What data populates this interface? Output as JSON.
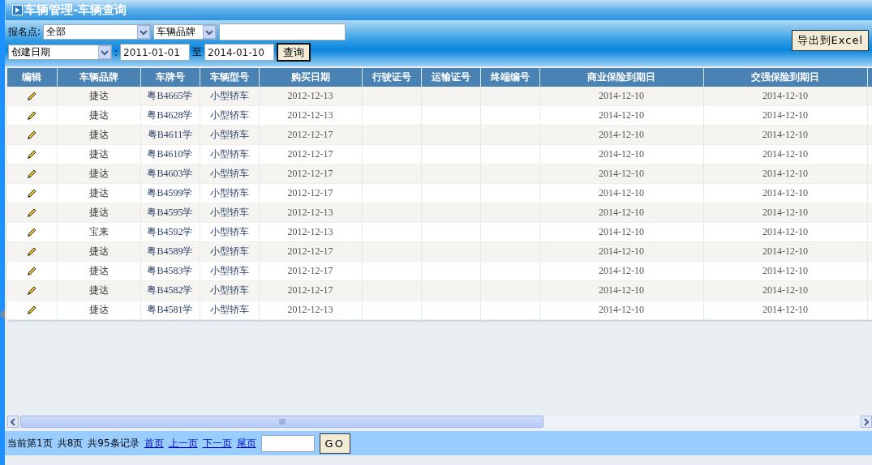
{
  "window": {
    "title": "车辆管理-车辆查询"
  },
  "filters": {
    "site_label": "报名点:",
    "site_select": "全部",
    "brand_select": "车辆品牌",
    "date_type_select": "创建日期",
    "date_separator": ":",
    "date_from": "2011-01-01",
    "range_label": "至",
    "date_to": "2014-01-10",
    "search_button": "查询"
  },
  "export_button": "导出到Excel",
  "table": {
    "columns": [
      "编辑",
      "车辆品牌",
      "车牌号",
      "车辆型号",
      "购买日期",
      "行驶证号",
      "运输证号",
      "终端编号",
      "商业保险到期日",
      "交强保险到期日"
    ],
    "rows": [
      {
        "brand": "捷达",
        "plate": "粤B4665学",
        "model": "小型轿车",
        "purchase_date": "2012-12-13",
        "commercial_expiry": "2014-12-10",
        "compulsory_expiry": "2014-12-10"
      },
      {
        "brand": "捷达",
        "plate": "粤B4628学",
        "model": "小型轿车",
        "purchase_date": "2012-12-13",
        "commercial_expiry": "2014-12-10",
        "compulsory_expiry": "2014-12-10"
      },
      {
        "brand": "捷达",
        "plate": "粤B4611学",
        "model": "小型轿车",
        "purchase_date": "2012-12-17",
        "commercial_expiry": "2014-12-10",
        "compulsory_expiry": "2014-12-10"
      },
      {
        "brand": "捷达",
        "plate": "粤B4610学",
        "model": "小型轿车",
        "purchase_date": "2012-12-17",
        "commercial_expiry": "2014-12-10",
        "compulsory_expiry": "2014-12-10"
      },
      {
        "brand": "捷达",
        "plate": "粤B4603学",
        "model": "小型轿车",
        "purchase_date": "2012-12-17",
        "commercial_expiry": "2014-12-10",
        "compulsory_expiry": "2014-12-10"
      },
      {
        "brand": "捷达",
        "plate": "粤B4599学",
        "model": "小型轿车",
        "purchase_date": "2012-12-17",
        "commercial_expiry": "2014-12-10",
        "compulsory_expiry": "2014-12-10"
      },
      {
        "brand": "捷达",
        "plate": "粤B4595学",
        "model": "小型轿车",
        "purchase_date": "2012-12-13",
        "commercial_expiry": "2014-12-10",
        "compulsory_expiry": "2014-12-10"
      },
      {
        "brand": "宝来",
        "plate": "粤B4592学",
        "model": "小型轿车",
        "purchase_date": "2012-12-13",
        "commercial_expiry": "2014-12-10",
        "compulsory_expiry": "2014-12-10"
      },
      {
        "brand": "捷达",
        "plate": "粤B4589学",
        "model": "小型轿车",
        "purchase_date": "2012-12-17",
        "commercial_expiry": "2014-12-10",
        "compulsory_expiry": "2014-12-10"
      },
      {
        "brand": "捷达",
        "plate": "粤B4583学",
        "model": "小型轿车",
        "purchase_date": "2012-12-17",
        "commercial_expiry": "2014-12-10",
        "compulsory_expiry": "2014-12-10"
      },
      {
        "brand": "捷达",
        "plate": "粤B4582学",
        "model": "小型轿车",
        "purchase_date": "2012-12-17",
        "commercial_expiry": "2014-12-10",
        "compulsory_expiry": "2014-12-10"
      },
      {
        "brand": "捷达",
        "plate": "粤B4581学",
        "model": "小型轿车",
        "purchase_date": "2012-12-13",
        "commercial_expiry": "2014-12-10",
        "compulsory_expiry": "2014-12-10"
      }
    ]
  },
  "pager": {
    "status": [
      "当前第1页",
      "共8页",
      "共95条记录"
    ],
    "links": [
      "首页",
      "上一页",
      "下一页",
      "尾页"
    ],
    "go_button": "GO"
  }
}
